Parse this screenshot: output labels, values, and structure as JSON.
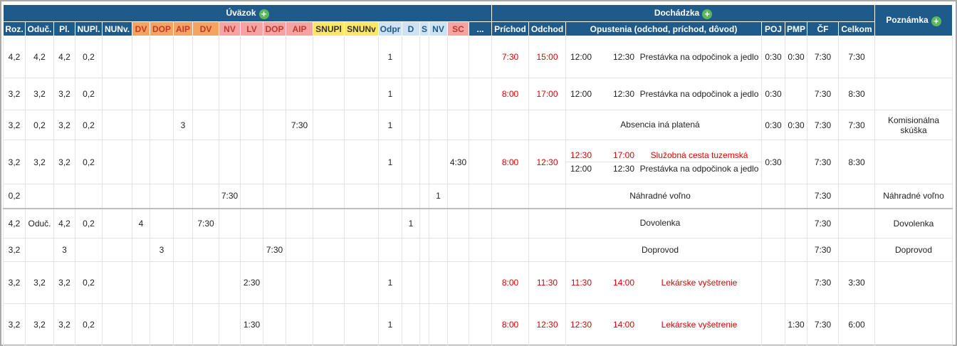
{
  "header": {
    "group_uvazok": "Úväzok",
    "group_dochadzka": "Dochádzka",
    "group_poznamka": "Poznámka",
    "cols": {
      "roz": "Roz.",
      "oduc": "Oduč.",
      "pl": "Pl.",
      "nupl": "NUPl.",
      "nunv": "NUNv.",
      "dv1": "DV",
      "dop1": "DOP",
      "aip1": "AIP",
      "dv2": "DV",
      "nv1": "NV",
      "lv": "LV",
      "dop2": "DOP",
      "aip2": "AIP",
      "snupl": "SNUPl",
      "snunv": "SNUNv",
      "odpr": "Odpr",
      "d": "D",
      "s": "S",
      "nv2": "NV",
      "sc": "SC",
      "more": "...",
      "prichod": "Príchod",
      "odchod": "Odchod",
      "opustenia": "Opustenia (odchod, príchod, dôvod)",
      "poj": "POJ",
      "pmp": "PMP",
      "cf": "ČF",
      "celkom": "Celkom"
    }
  },
  "rows": [
    {
      "roz": "4,2",
      "oduc": "4,2",
      "pl": "4,2",
      "nupl": "0,2",
      "nunv": "",
      "dv1": "",
      "dop1": "",
      "aip1": "",
      "dv2": "",
      "nv1": "",
      "lv": "",
      "dop2": "",
      "aip2": "",
      "snupl": "",
      "snunv": "",
      "odpr": "1",
      "d": "",
      "s": "",
      "nv2": "",
      "sc": "",
      "more": "",
      "prichod": "7:30",
      "odchod": "15:00",
      "ops": [
        {
          "from": "12:00",
          "to": "12:30",
          "reason": "Prestávka na odpočinok a jedlo",
          "red": false
        }
      ],
      "poj": "0:30",
      "pmp": "0:30",
      "cf": "7:30",
      "celkom": "7:30",
      "pozn": ""
    },
    {
      "roz": "3,2",
      "oduc": "3,2",
      "pl": "3,2",
      "nupl": "0,2",
      "nunv": "",
      "dv1": "",
      "dop1": "",
      "aip1": "",
      "dv2": "",
      "nv1": "",
      "lv": "",
      "dop2": "",
      "aip2": "",
      "snupl": "",
      "snunv": "",
      "odpr": "1",
      "d": "",
      "s": "",
      "nv2": "",
      "sc": "",
      "more": "",
      "prichod": "8:00",
      "odchod": "17:00",
      "ops": [
        {
          "from": "12:00",
          "to": "12:30",
          "reason": "Prestávka na odpočinok a jedlo",
          "red": false
        }
      ],
      "poj": "0:30",
      "pmp": "",
      "cf": "7:30",
      "celkom": "8:30",
      "pozn": ""
    },
    {
      "roz": "3,2",
      "oduc": "0,2",
      "pl": "3,2",
      "nupl": "0,2",
      "nunv": "",
      "dv1": "",
      "dop1": "",
      "aip1": "3",
      "dv2": "",
      "nv1": "",
      "lv": "",
      "dop2": "",
      "aip2": "7:30",
      "snupl": "",
      "snunv": "",
      "odpr": "1",
      "d": "",
      "s": "",
      "nv2": "",
      "sc": "",
      "more": "",
      "prichod": "",
      "odchod": "",
      "ops": [
        {
          "from": "",
          "to": "",
          "reason": "Absencia iná platená",
          "red": false
        }
      ],
      "poj": "0:30",
      "pmp": "0:30",
      "cf": "7:30",
      "celkom": "7:30",
      "pozn": "Komisionálna skúška"
    },
    {
      "roz": "3,2",
      "oduc": "3,2",
      "pl": "3,2",
      "nupl": "0,2",
      "nunv": "",
      "dv1": "",
      "dop1": "",
      "aip1": "",
      "dv2": "",
      "nv1": "",
      "lv": "",
      "dop2": "",
      "aip2": "",
      "snupl": "",
      "snunv": "",
      "odpr": "1",
      "d": "",
      "s": "",
      "nv2": "",
      "sc": "4:30",
      "more": "",
      "prichod": "8:00",
      "odchod": "12:30",
      "ops": [
        {
          "from": "12:30",
          "to": "17:00",
          "reason": "Služobná cesta tuzemská",
          "red": true
        },
        {
          "from": "12:00",
          "to": "12:30",
          "reason": "Prestávka na odpočinok a jedlo",
          "red": false
        }
      ],
      "poj": "0:30",
      "pmp": "",
      "cf": "7:30",
      "celkom": "8:30",
      "pozn": ""
    },
    {
      "roz": "0,2",
      "oduc": "",
      "pl": "",
      "nupl": "",
      "nunv": "",
      "dv1": "",
      "dop1": "",
      "aip1": "",
      "dv2": "",
      "nv1": "7:30",
      "lv": "",
      "dop2": "",
      "aip2": "",
      "snupl": "",
      "snunv": "",
      "odpr": "",
      "d": "",
      "s": "",
      "nv2": "1",
      "sc": "",
      "more": "",
      "prichod": "",
      "odchod": "",
      "ops": [
        {
          "from": "",
          "to": "",
          "reason": "Náhradné voľno",
          "red": false
        }
      ],
      "poj": "",
      "pmp": "",
      "cf": "7:30",
      "celkom": "",
      "pozn": "Náhradné voľno"
    },
    {
      "roz": "4,2",
      "oduc": "Oduč.",
      "pl": "4,2",
      "nupl": "0,2",
      "nunv": "",
      "dv1": "4",
      "dop1": "",
      "aip1": "",
      "dv2": "7:30",
      "nv1": "",
      "lv": "",
      "dop2": "",
      "aip2": "",
      "snupl": "",
      "snunv": "",
      "odpr": "",
      "d": "1",
      "s": "",
      "nv2": "",
      "sc": "",
      "more": "",
      "prichod": "",
      "odchod": "",
      "ops": [
        {
          "from": "",
          "to": "",
          "reason": "Dovolenka",
          "red": false
        }
      ],
      "poj": "",
      "pmp": "",
      "cf": "7:30",
      "celkom": "",
      "pozn": "Dovolenka"
    },
    {
      "roz": "3,2",
      "oduc": "",
      "pl": "3",
      "nupl": "",
      "nunv": "",
      "dv1": "",
      "dop1": "3",
      "aip1": "",
      "dv2": "",
      "nv1": "",
      "lv": "",
      "dop2": "7:30",
      "aip2": "",
      "snupl": "",
      "snunv": "",
      "odpr": "",
      "d": "",
      "s": "",
      "nv2": "",
      "sc": "",
      "more": "",
      "prichod": "",
      "odchod": "",
      "ops": [
        {
          "from": "",
          "to": "",
          "reason": "Doprovod",
          "red": false
        }
      ],
      "poj": "",
      "pmp": "",
      "cf": "7:30",
      "celkom": "",
      "pozn": "Doprovod"
    },
    {
      "roz": "3,2",
      "oduc": "3,2",
      "pl": "3,2",
      "nupl": "0,2",
      "nunv": "",
      "dv1": "",
      "dop1": "",
      "aip1": "",
      "dv2": "",
      "nv1": "",
      "lv": "2:30",
      "dop2": "",
      "aip2": "",
      "snupl": "",
      "snunv": "",
      "odpr": "1",
      "d": "",
      "s": "",
      "nv2": "",
      "sc": "",
      "more": "",
      "prichod": "8:00",
      "odchod": "11:30",
      "ops": [
        {
          "from": "11:30",
          "to": "14:00",
          "reason": "Lekárske vyšetrenie",
          "red": true
        }
      ],
      "poj": "",
      "pmp": "",
      "cf": "7:30",
      "celkom": "3:30",
      "pozn": ""
    },
    {
      "roz": "3,2",
      "oduc": "3,2",
      "pl": "3,2",
      "nupl": "0,2",
      "nunv": "",
      "dv1": "",
      "dop1": "",
      "aip1": "",
      "dv2": "",
      "nv1": "",
      "lv": "1:30",
      "dop2": "",
      "aip2": "",
      "snupl": "",
      "snunv": "",
      "odpr": "1",
      "d": "",
      "s": "",
      "nv2": "",
      "sc": "",
      "more": "",
      "prichod": "8:00",
      "odchod": "12:30",
      "ops": [
        {
          "from": "12:30",
          "to": "14:00",
          "reason": "Lekárske vyšetrenie",
          "red": true
        }
      ],
      "poj": "",
      "pmp": "1:30",
      "cf": "7:30",
      "celkom": "6:00",
      "pozn": ""
    }
  ]
}
